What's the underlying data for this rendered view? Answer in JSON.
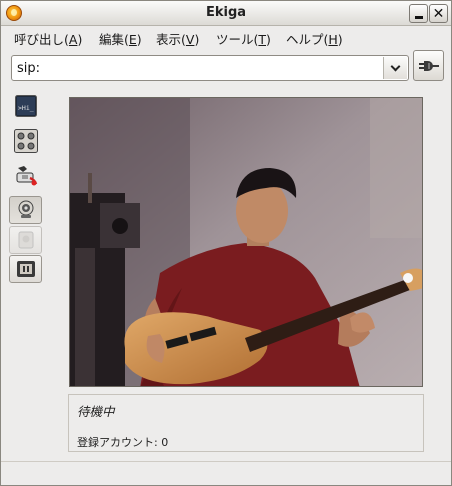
{
  "window": {
    "title": "Ekiga"
  },
  "menu": [
    {
      "label": "呼び出し(",
      "key": "A",
      "end": ")"
    },
    {
      "label": "編集(",
      "key": "E",
      "end": ")"
    },
    {
      "label": "表示(",
      "key": "V",
      "end": ")"
    },
    {
      "label": "ツール(",
      "key": "T",
      "end": ")"
    },
    {
      "label": "ヘルプ(",
      "key": "H",
      "end": ")"
    }
  ],
  "address": {
    "value": "sip:"
  },
  "toolbar": {
    "tools": [
      {
        "name": "text-chat",
        "icon_text": ">Hi_"
      },
      {
        "name": "dialpad"
      },
      {
        "name": "phone-call"
      },
      {
        "name": "webcam"
      },
      {
        "name": "webcam-disabled"
      },
      {
        "name": "video-window"
      }
    ]
  },
  "status": {
    "text": "待機中",
    "accounts": "登録アカウント: 0"
  },
  "colors": {
    "window_bg": "#edeceb",
    "titlebar_top": "#fbfbfa",
    "titlebar_bottom": "#dcdad5"
  }
}
